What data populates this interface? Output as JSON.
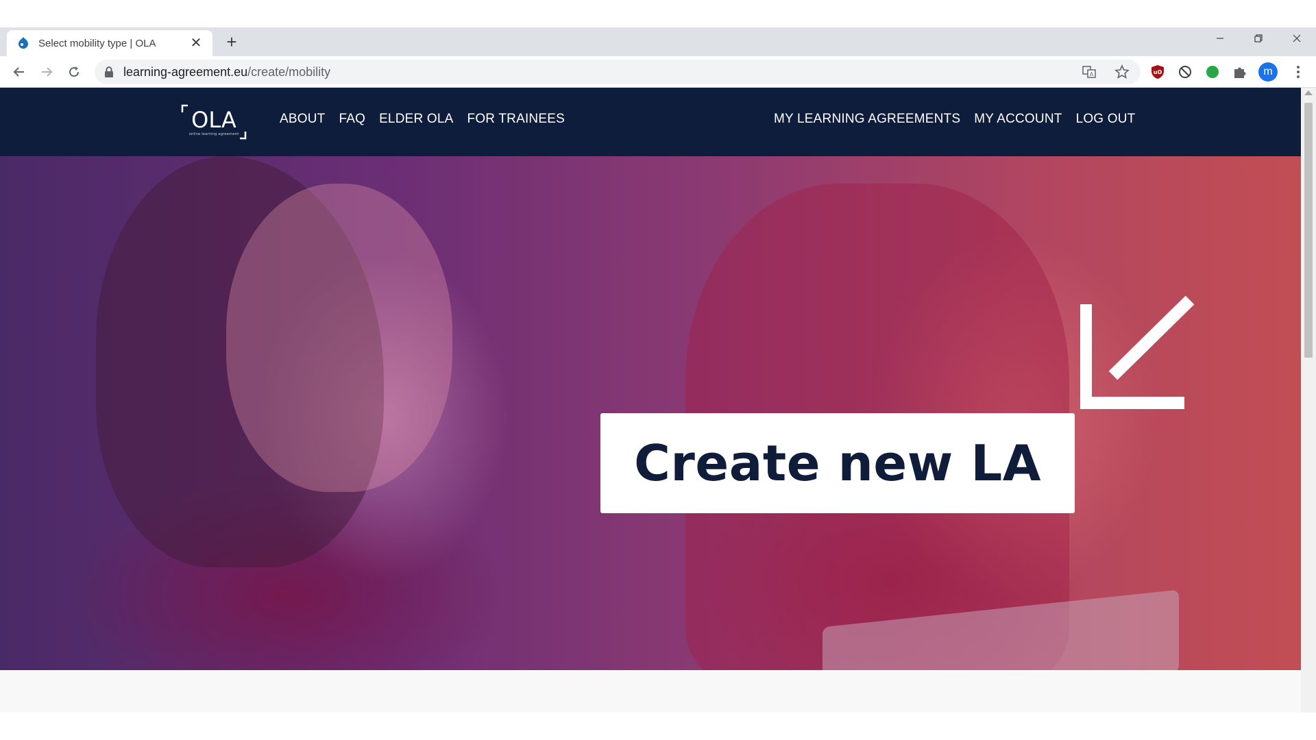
{
  "browser": {
    "tab": {
      "title": "Select mobility type | OLA",
      "favicon": "drupal-icon",
      "close_icon": "close-icon"
    },
    "new_tab_icon": "plus-icon",
    "window_controls": [
      "minimize-icon",
      "restore-icon",
      "close-icon"
    ],
    "nav": [
      "back-arrow-icon",
      "forward-arrow-icon",
      "reload-icon"
    ],
    "address": {
      "host": "learning-agreement.eu",
      "path": "/create/mobility",
      "lock_icon": "lock-icon"
    },
    "omnibox_icons": [
      "translate-icon",
      "star-icon"
    ],
    "extensions": [
      "ublock-icon",
      "block-icon",
      "green-circle-icon",
      "puzzle-icon"
    ],
    "profile_initial": "m",
    "menu_icon": "kebab-menu-icon"
  },
  "site": {
    "logo": {
      "text": "OLA",
      "tagline": "online learning agreement"
    },
    "menu_left": [
      "ABOUT",
      "FAQ",
      "ELDER OLA",
      "FOR TRAINEES"
    ],
    "menu_right": [
      "MY LEARNING AGREEMENTS",
      "MY ACCOUNT",
      "LOG OUT"
    ],
    "colors": {
      "nav_bg": "#0e1d3b",
      "cta_text": "#0f1c3a"
    }
  },
  "hero": {
    "cta_label": "Create new LA",
    "arrow_icon": "arrow-down-left-icon"
  }
}
